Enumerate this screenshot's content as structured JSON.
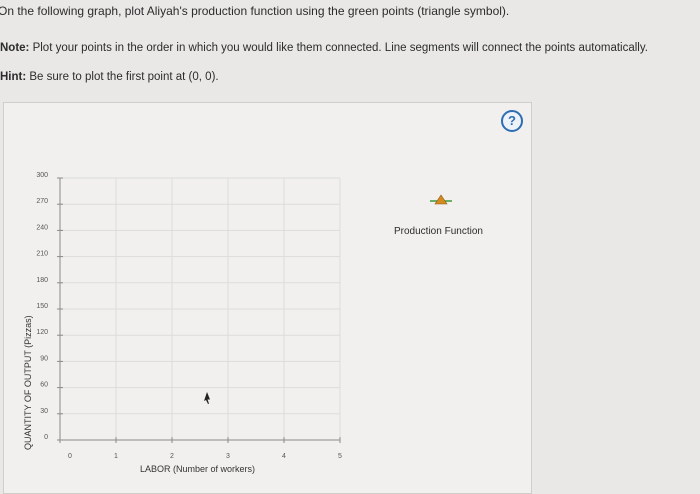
{
  "instructions": {
    "line1": "On the following graph, plot Aliyah's production function using the green points (triangle symbol).",
    "note_label": "Note:",
    "note_text": " Plot your points in the order in which you would like them connected. Line segments will connect the points automatically.",
    "hint_label": "Hint:",
    "hint_text": " Be sure to plot the first point at (0, 0)."
  },
  "help": {
    "label": "?",
    "icon": "question-mark-icon"
  },
  "legend": {
    "label": "Production Function",
    "color": "#3a9a3a",
    "icon": "triangle-icon"
  },
  "chart_data": {
    "type": "scatter",
    "xlabel": "LABOR (Number of workers)",
    "ylabel": "QUANTITY OF OUTPUT (Pizzas)",
    "xlim": [
      0,
      5
    ],
    "ylim": [
      0,
      300
    ],
    "x_ticks": [
      "0",
      "1",
      "2",
      "3",
      "4",
      "5"
    ],
    "y_ticks": [
      "0",
      "30",
      "60",
      "90",
      "120",
      "150",
      "180",
      "210",
      "240",
      "270",
      "300"
    ],
    "grid": true,
    "series": [
      {
        "values": []
      }
    ]
  }
}
